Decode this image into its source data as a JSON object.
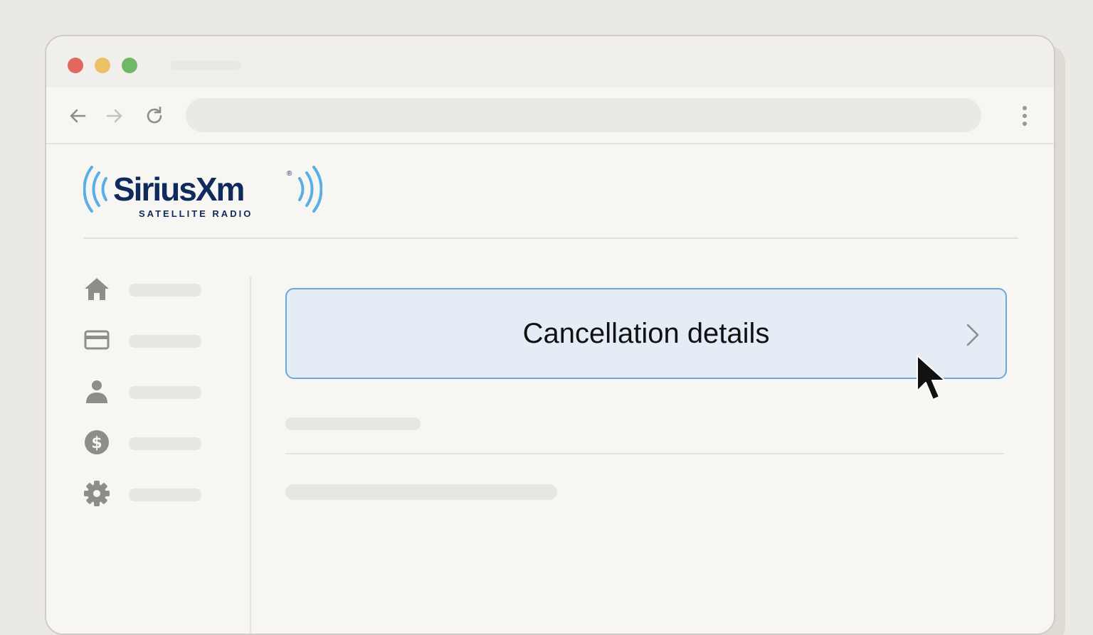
{
  "browser": {
    "window_controls": [
      "close",
      "minimize",
      "maximize"
    ],
    "nav_icons": [
      "arrow-left-icon",
      "arrow-right-icon",
      "reload-icon",
      "more-vertical-icon"
    ]
  },
  "brand": {
    "wordmark": "SiriusXm",
    "registered": "®",
    "tagline": "SATELLITE RADIO",
    "color": "#0f2a5c",
    "wave_color": "#5aaee6"
  },
  "sidebar": {
    "items": [
      {
        "icon": "home-icon"
      },
      {
        "icon": "credit-card-icon"
      },
      {
        "icon": "user-icon"
      },
      {
        "icon": "dollar-icon"
      },
      {
        "icon": "gear-icon"
      }
    ]
  },
  "main": {
    "cancellation_button": {
      "label": "Cancellation details",
      "icon": "chevron-right-icon",
      "background": "#e4ecf6",
      "border": "#6ea7d8"
    }
  }
}
